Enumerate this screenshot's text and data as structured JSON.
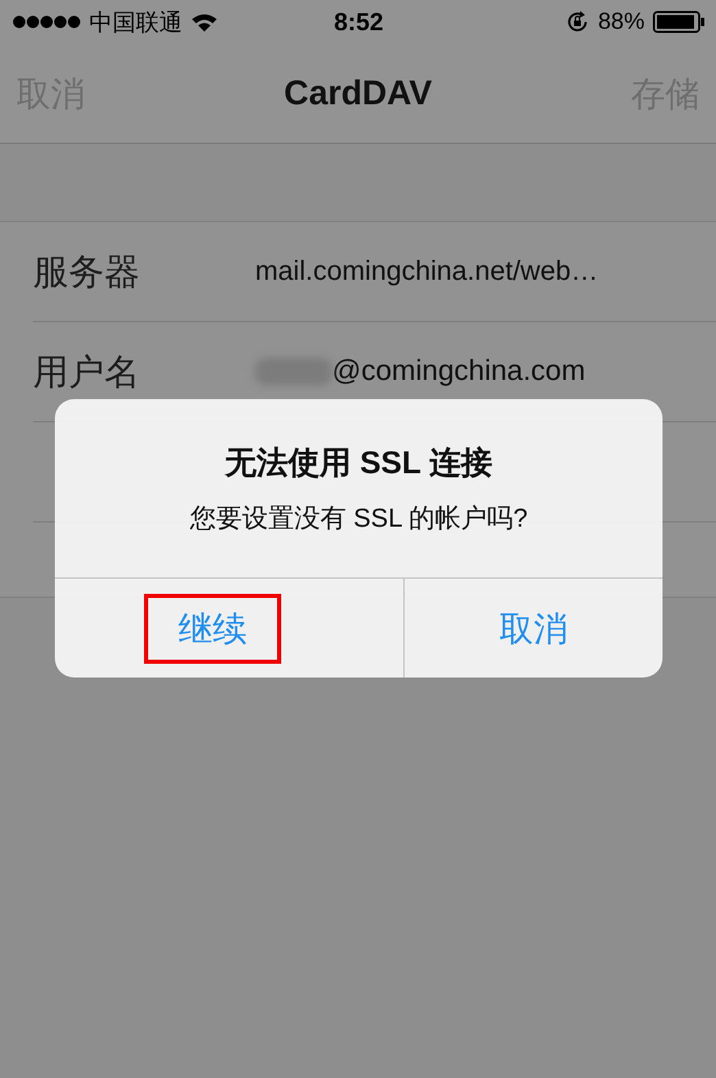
{
  "status_bar": {
    "carrier": "中国联通",
    "time": "8:52",
    "battery": "88%"
  },
  "nav_bar": {
    "left": "取消",
    "title": "CardDAV",
    "right": "存储"
  },
  "rows": [
    {
      "label": "服务器",
      "value": "mail.comingchina.net/web…",
      "redacted": false
    },
    {
      "label": "用户名",
      "value": "@comingchina.com",
      "redacted": true
    }
  ],
  "alert": {
    "title": "无法使用 SSL 连接",
    "message": "您要设置没有 SSL 的帐户吗?",
    "buttons": [
      {
        "label": "继续",
        "highlighted": true
      },
      {
        "label": "取消",
        "highlighted": false
      }
    ]
  }
}
